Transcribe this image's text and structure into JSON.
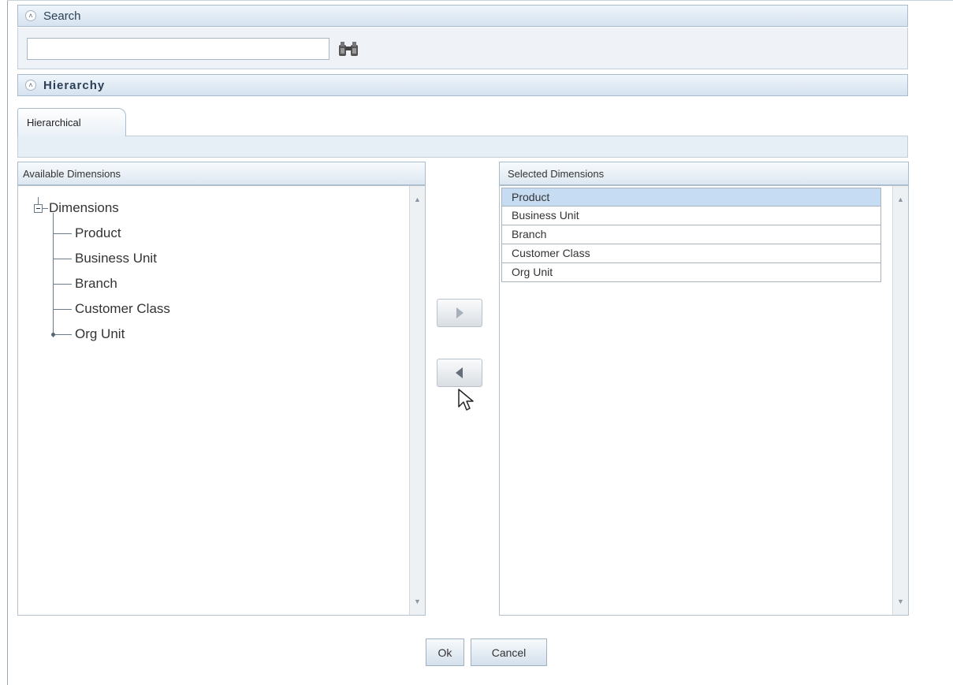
{
  "search": {
    "title": "Search",
    "input_value": "",
    "search_icon": "binoculars-icon"
  },
  "hierarchy": {
    "title": "Hierarchy",
    "tab_label": "Hierarchical"
  },
  "available": {
    "header": "Available Dimensions",
    "root_label": "Dimensions",
    "items": [
      {
        "label": "Product"
      },
      {
        "label": "Business Unit"
      },
      {
        "label": "Branch"
      },
      {
        "label": "Customer Class"
      },
      {
        "label": "Org Unit"
      }
    ]
  },
  "selected": {
    "header": "Selected Dimensions",
    "items": [
      {
        "label": "Product",
        "selected": true
      },
      {
        "label": "Business Unit"
      },
      {
        "label": "Branch"
      },
      {
        "label": "Customer Class"
      },
      {
        "label": "Org Unit"
      }
    ]
  },
  "buttons": {
    "ok": "Ok",
    "cancel": "Cancel"
  }
}
